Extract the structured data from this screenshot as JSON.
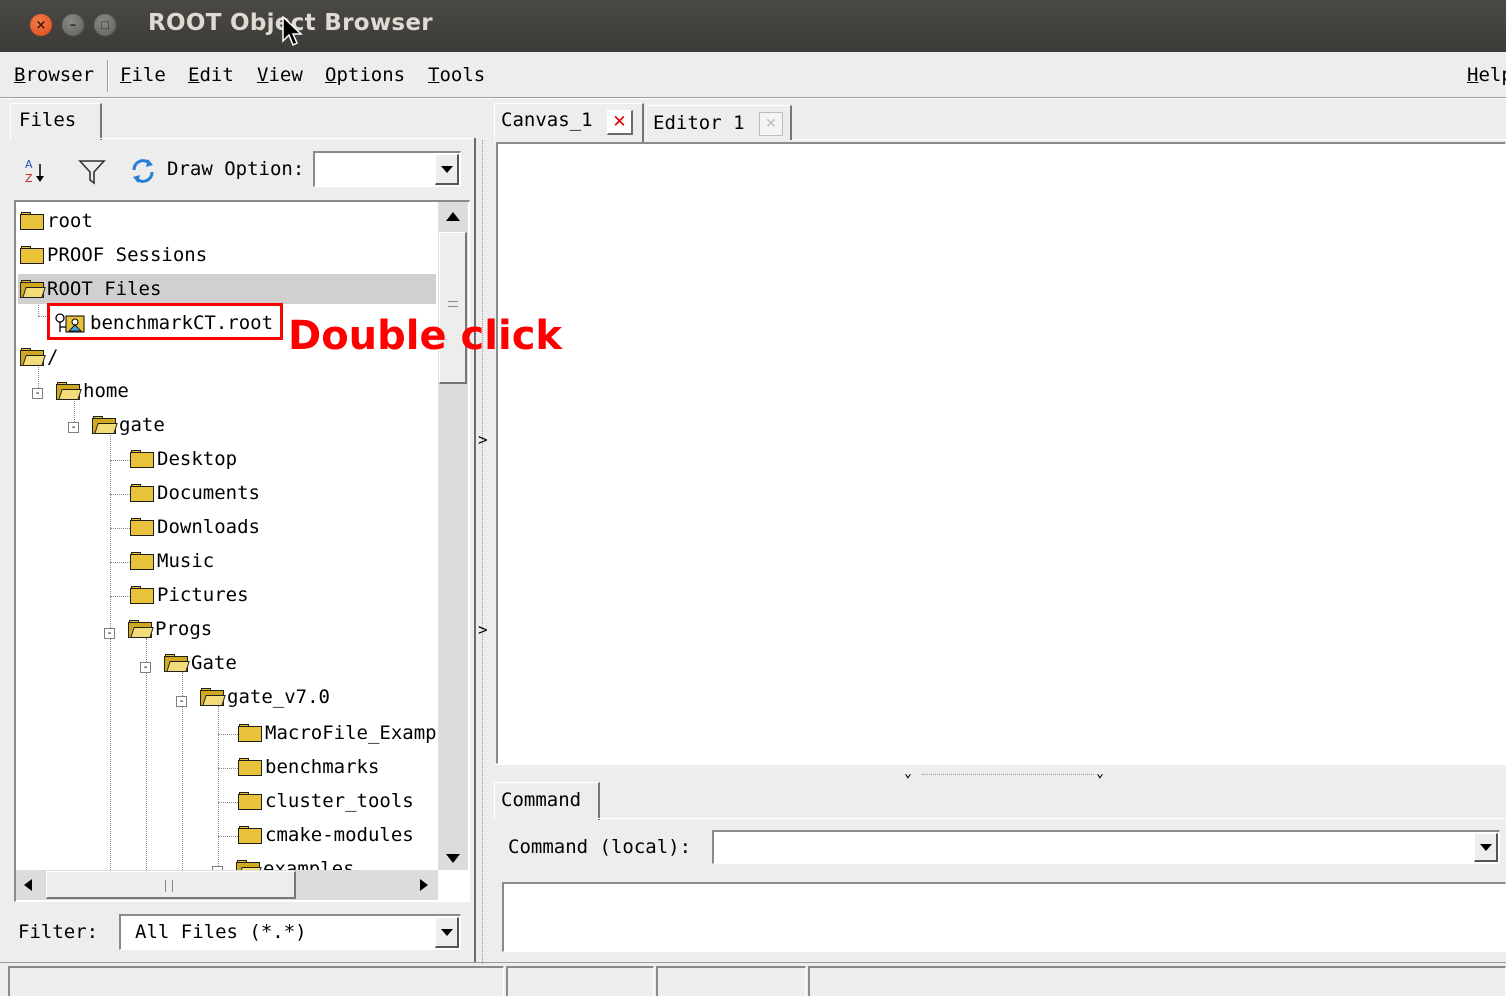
{
  "window": {
    "title": "ROOT Object Browser",
    "close_glyph": "×",
    "min_glyph": "–",
    "max_glyph": "□"
  },
  "menu": {
    "browser": {
      "first": "B",
      "rest": "rowser"
    },
    "file": {
      "first": "F",
      "rest": "ile"
    },
    "edit": {
      "first": "E",
      "rest": "dit"
    },
    "view": {
      "first": "V",
      "rest": "iew"
    },
    "options": {
      "first": "O",
      "rest": "ptions"
    },
    "tools": {
      "first": "T",
      "rest": "ools"
    },
    "help": {
      "first": "H",
      "rest": "elp"
    }
  },
  "left_panel": {
    "tab_label": "Files",
    "draw_option_label": "Draw Option:",
    "draw_option_value": "",
    "tree": [
      {
        "label": "root",
        "kind": "folder"
      },
      {
        "label": "PROOF Sessions",
        "kind": "folder"
      },
      {
        "label": "ROOT Files",
        "kind": "folder-open",
        "selected": true
      },
      {
        "label": "benchmarkCT.root",
        "kind": "rootfile"
      },
      {
        "label": "/",
        "kind": "folder-open"
      },
      {
        "label": "home",
        "kind": "folder-open"
      },
      {
        "label": "gate",
        "kind": "folder-open"
      },
      {
        "label": "Desktop",
        "kind": "folder"
      },
      {
        "label": "Documents",
        "kind": "folder"
      },
      {
        "label": "Downloads",
        "kind": "folder"
      },
      {
        "label": "Music",
        "kind": "folder"
      },
      {
        "label": "Pictures",
        "kind": "folder"
      },
      {
        "label": "Progs",
        "kind": "folder-open"
      },
      {
        "label": "Gate",
        "kind": "folder-open"
      },
      {
        "label": "gate_v7.0",
        "kind": "folder-open"
      },
      {
        "label": "MacroFile_Examp",
        "kind": "folder"
      },
      {
        "label": "benchmarks",
        "kind": "folder"
      },
      {
        "label": "cluster_tools",
        "kind": "folder"
      },
      {
        "label": "cmake-modules",
        "kind": "folder"
      },
      {
        "label": "examples",
        "kind": "folder-open"
      }
    ],
    "filter_label": "Filter:",
    "filter_value": "All Files (*.*)"
  },
  "right_panel": {
    "tabs": [
      {
        "label": "Canvas_1",
        "active": true
      },
      {
        "label": "Editor 1",
        "active": false
      }
    ],
    "command_tab_label": "Command",
    "command_label": "Command (local):",
    "command_value": ""
  },
  "annotation": {
    "text": "Double click",
    "color": "#ff0000"
  },
  "icons": [
    "sort-az-icon",
    "filter-funnel-icon",
    "refresh-icon",
    "folder-icon",
    "root-file-icon",
    "close-tab-icon"
  ]
}
